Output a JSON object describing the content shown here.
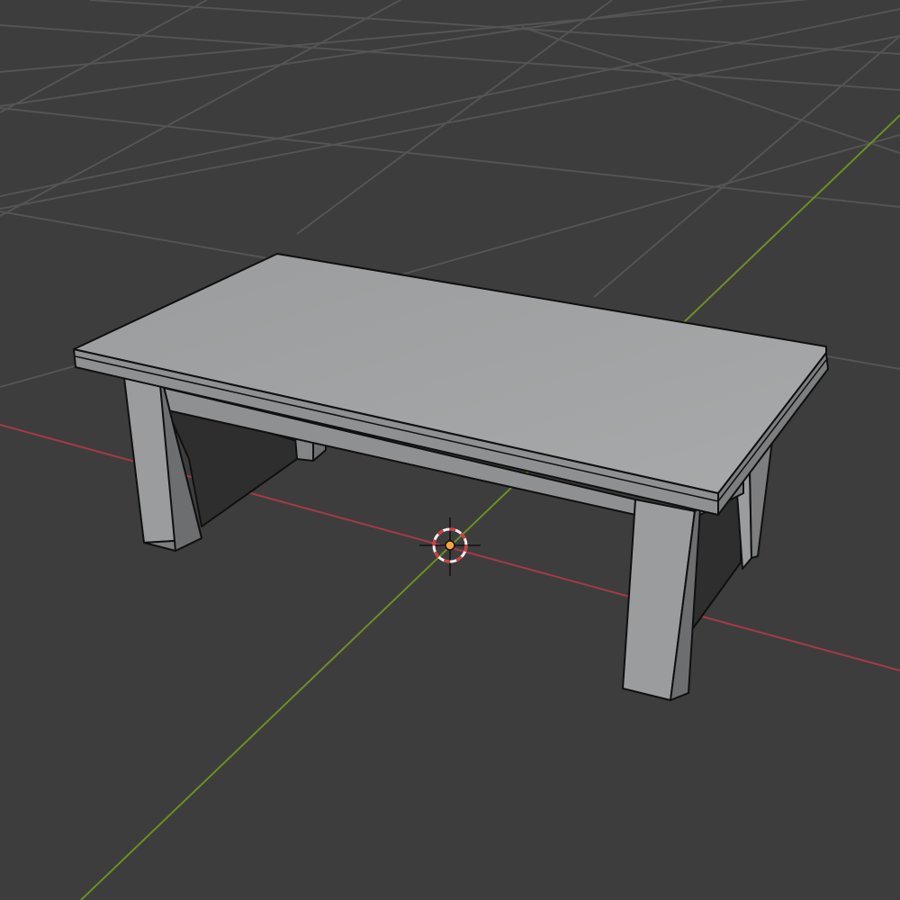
{
  "viewport": {
    "mode": "3D Viewport",
    "shading": "solid",
    "background_color": "#3d3d3d"
  },
  "colors": {
    "grid_line": "#545454",
    "axis_x": "#a43a47",
    "axis_y": "#6a8f23",
    "edge": "#101010",
    "top_face": "#a2a4a5",
    "front_face": "#8e9091",
    "side_face": "#7c7e7f",
    "shadow_face": "#2e2e2e",
    "leg_light": "#9a9c9d",
    "leg_mid": "#838586",
    "leg_dark": "#6c6e6f",
    "cursor_fill": "#f7a33b",
    "cursor_ring_red": "#d63b3b",
    "cursor_ring_white": "#f0f0f0"
  },
  "scene": {
    "objects": [
      {
        "name": "table",
        "type": "mesh",
        "selected": false
      }
    ],
    "cursor_icon": "3d-cursor-icon",
    "origin_icon": "object-origin-icon"
  }
}
